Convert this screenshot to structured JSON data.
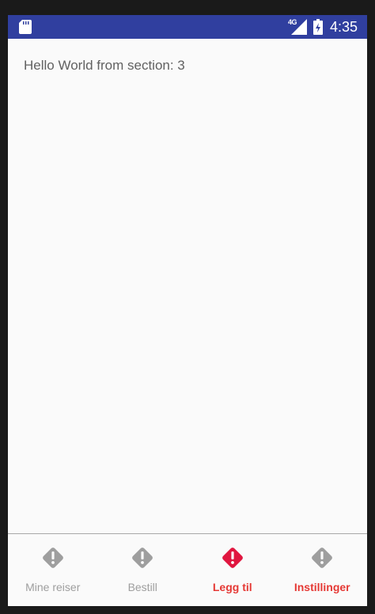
{
  "status_bar": {
    "network_type": "4G",
    "time": "4:35",
    "icons": [
      "sd-card-icon",
      "signal-icon",
      "battery-icon"
    ]
  },
  "content": {
    "section_text": "Hello World from section: 3"
  },
  "bottom_nav": {
    "items": [
      {
        "label": "Mine reiser",
        "icon": "alert-diamond-icon",
        "state": "inactive"
      },
      {
        "label": "Bestill",
        "icon": "alert-diamond-icon",
        "state": "inactive"
      },
      {
        "label": "Legg til",
        "icon": "alert-diamond-icon",
        "state": "active"
      },
      {
        "label": "Instillinger",
        "icon": "alert-diamond-icon",
        "state": "inactive-red-label"
      }
    ]
  },
  "colors": {
    "status_bar": "#303f9f",
    "background": "#fafafa",
    "inactive": "#9e9e9e",
    "active": "#e0163f",
    "accent_label": "#e53935",
    "body_text": "#616161"
  }
}
